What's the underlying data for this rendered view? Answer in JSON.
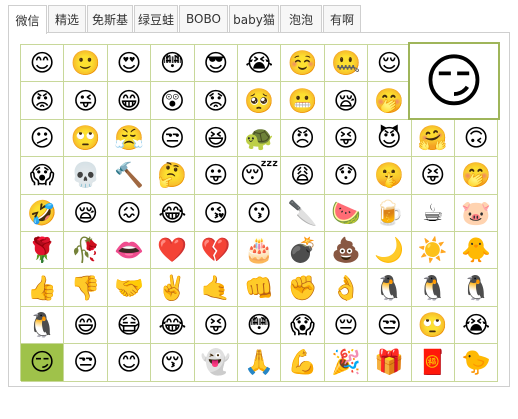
{
  "tabs": [
    {
      "label": "微信",
      "active": true
    },
    {
      "label": "精选",
      "active": false
    },
    {
      "label": "免斯基",
      "active": false
    },
    {
      "label": "绿豆蛙",
      "active": false
    },
    {
      "label": "BOBO",
      "active": false
    },
    {
      "label": "baby猫",
      "active": false
    },
    {
      "label": "泡泡",
      "active": false
    },
    {
      "label": "有啊",
      "active": false
    }
  ],
  "emoji_rows": [
    [
      "😊",
      "🙂",
      "😍",
      "😳",
      "😎",
      "😭",
      "☺️",
      "🤐",
      "😌",
      "😑",
      "😐"
    ],
    [
      "😡",
      "😜",
      "😁",
      "😲",
      "😟",
      "🥺",
      "😬",
      "😪",
      "🤭",
      "😅",
      "🙃"
    ],
    [
      "😕",
      "🙄",
      "😤",
      "😒",
      "😆",
      "🐢",
      "😠",
      "😝",
      "😈",
      "🤗",
      "🙃"
    ],
    [
      "😱",
      "💀",
      "🔨",
      "🤔",
      "😛",
      "😴",
      "😩",
      "😯",
      "🤫",
      "😝",
      "🤭"
    ],
    [
      "🤣",
      "😪",
      "😖",
      "😂",
      "😘",
      "😗",
      "🔪",
      "🍉",
      "🍺",
      "☕",
      "🐷"
    ],
    [
      "🌹",
      "🥀",
      "👄",
      "❤️",
      "💔",
      "🎂",
      "💣",
      "💩",
      "🌙",
      "☀️",
      "🐥"
    ],
    [
      "👍",
      "👎",
      "🤝",
      "✌️",
      "🤙",
      "👊",
      "✊",
      "👌",
      "🐧",
      "🐧",
      "🐧"
    ],
    [
      "🐧",
      "😄",
      "😷",
      "😂",
      "😝",
      "😳",
      "😱",
      "😔",
      "😒",
      "🙄",
      "😭"
    ],
    [
      "😏",
      "😒",
      "😊",
      "😚",
      "👻",
      "🙏",
      "💪",
      "🎉",
      "🎁",
      "🧧",
      "🐤"
    ]
  ],
  "selected": {
    "row": 8,
    "col": 0
  },
  "preview_emoji": "😏"
}
